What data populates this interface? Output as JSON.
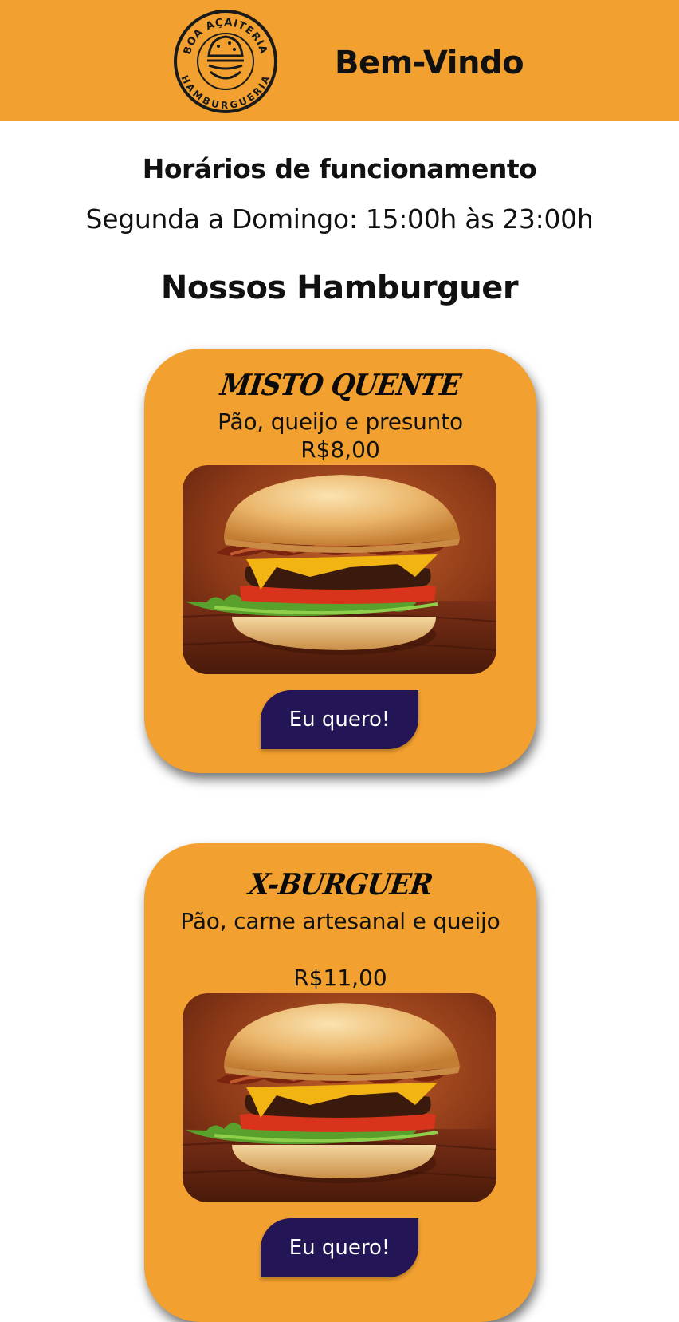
{
  "header": {
    "logo": {
      "top_text": "BOA AÇAITERIA",
      "bottom_text": "HAMBURGUERIA"
    },
    "welcome": "Bem-Vindo"
  },
  "hours": {
    "title": "Horários de funcionamento",
    "text": "Segunda a Domingo: 15:00h às 23:00h"
  },
  "section_title": "Nossos Hamburguer",
  "products": [
    {
      "name": "MISTO QUENTE",
      "description": "Pão, queijo e presunto",
      "price": "R$8,00",
      "button": "Eu quero!"
    },
    {
      "name": "X-BURGUER",
      "description": "Pão, carne artesanal e queijo",
      "price": "R$11,00",
      "button": "Eu quero!"
    }
  ],
  "colors": {
    "header_bg": "#f2a02f",
    "card_bg": "#f2a02f",
    "button_bg": "#241656",
    "button_text": "#ffffff"
  }
}
